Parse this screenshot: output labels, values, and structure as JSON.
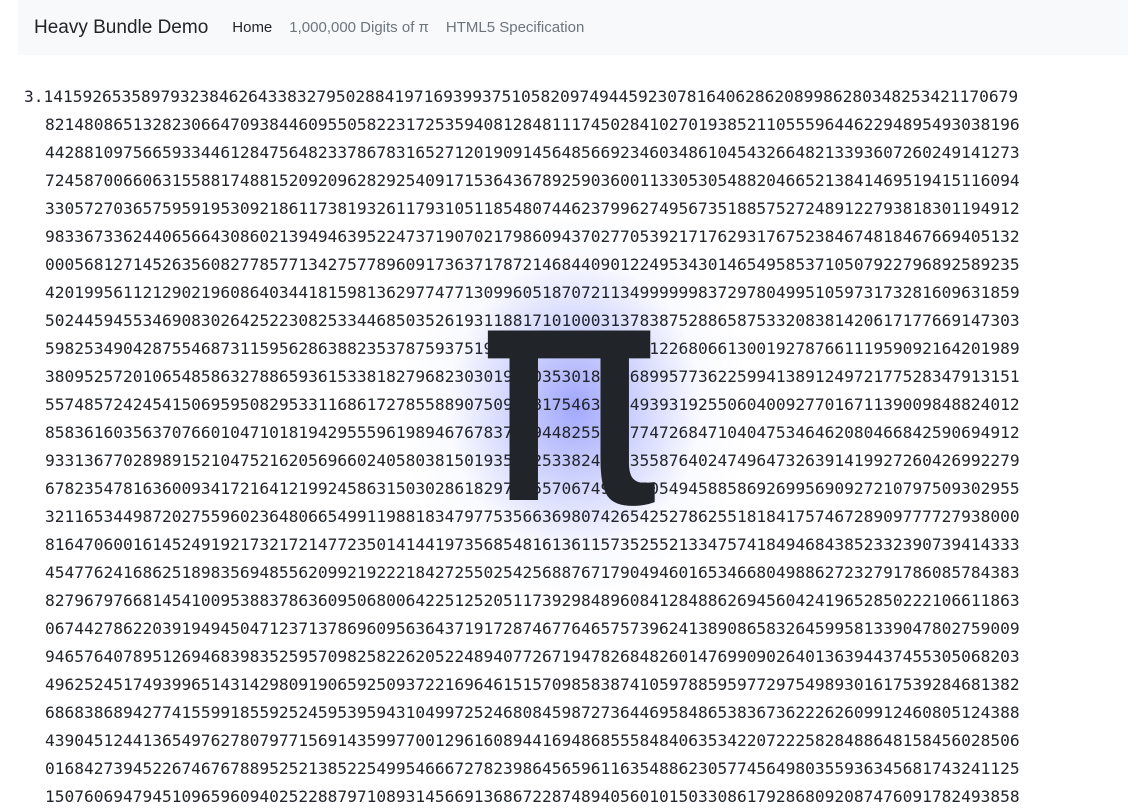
{
  "navbar": {
    "brand": "Heavy Bundle Demo",
    "links": [
      {
        "label": "Home",
        "active": true
      },
      {
        "label": "1,000,000 Digits of π",
        "active": false
      },
      {
        "label": "HTML5 Specification",
        "active": false
      }
    ]
  },
  "pi": {
    "symbol": "π",
    "digit_lines": [
      "3.1415926535897932384626433832795028841971693993751058209749445923078164062862089986280348253421170679",
      "8214808651328230664709384460955058223172535940812848111745028410270193852110555964462294895493038196",
      "4428810975665933446128475648233786783165271201909145648566923460348610454326648213393607260249141273",
      "7245870066063155881748815209209628292540917153643678925903600113305305488204665213841469519415116094",
      "3305727036575959195309218611738193261179310511854807446237996274956735188575272489122793818301194912",
      "9833673362440656643086021394946395224737190702179860943702770539217176293176752384674818467669405132",
      "0005681271452635608277857713427577896091736371787214684409012249534301465495853710507922796892589235",
      "4201995611212902196086403441815981362977477130996051870721134999999837297804995105973173281609631859",
      "5024459455346908302642522308253344685035261931188171010003137838752886587533208381420617177669147303",
      "5982534904287554687311595628638823537875937519577818577805321712268066130019278766111959092164201989",
      "3809525720106548586327886593615338182796823030195203530185296899577362259941389124972177528347913151",
      "5574857242454150695950829533116861727855889075098381754637464939319255060400927701671139009848824012",
      "8583616035637076601047101819429555961989467678374494482553797747268471040475346462080466842590694912",
      "9331367702898915210475216205696602405803815019351125338243003558764024749647326391419927260426992279",
      "6782354781636009341721641219924586315030286182974555706749838505494588586926995690927210797509302955",
      "3211653449872027559602364806654991198818347977535663698074265425278625518184175746728909777727938000",
      "8164706001614524919217321721477235014144197356854816136115735255213347574184946843852332390739414333",
      "4547762416862518983569485562099219222184272550254256887671790494601653466804988627232791786085784383",
      "8279679766814541009538837863609506800642251252051173929848960841284886269456042419652850222106611863",
      "0674427862203919494504712371378696095636437191728746776465757396241389086583264599581339047802759009",
      "9465764078951269468398352595709825822620522489407726719478268482601476990902640136394437455305068203",
      "4962524517493996514314298091906592509372216964615157098583874105978859597729754989301617539284681382",
      "6868386894277415599185592524595395943104997252468084598727364469584865383673622262609912460805124388",
      "4390451244136549762780797715691435997700129616089441694868555848406353422072225828488648158456028506",
      "0168427394522674676788952521385225499546667278239864565961163548862305774564980355936345681743241125",
      "1507606947945109659609402522887971089314566913686722874894056010150330861792868092087476091782493858"
    ]
  }
}
